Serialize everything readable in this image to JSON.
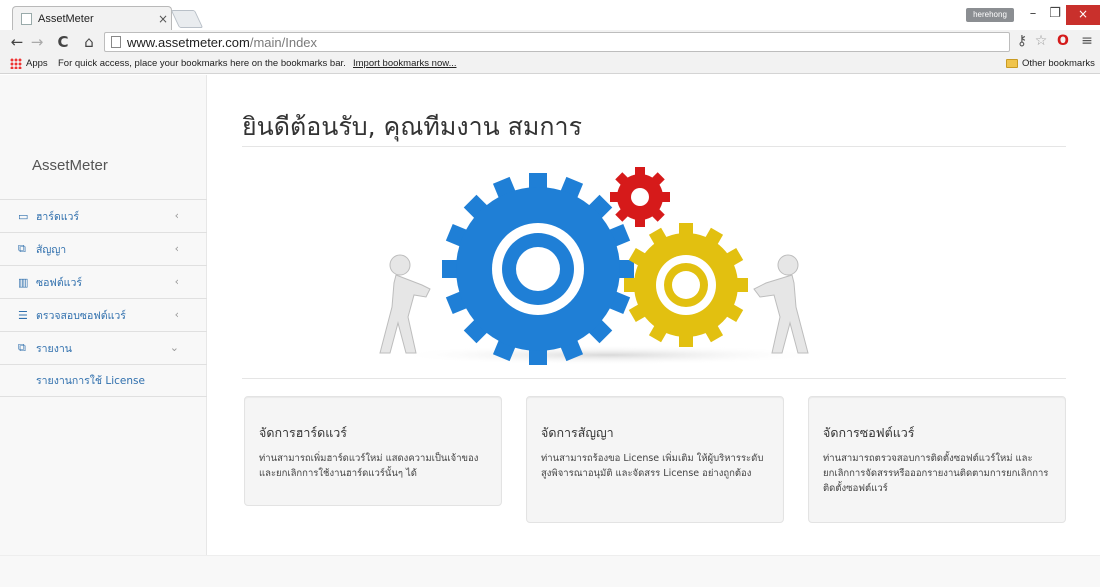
{
  "browser": {
    "tab_title": "AssetMeter",
    "tab_close": "×",
    "user_chip": "herehong",
    "window": {
      "minimize": "–",
      "maximize": "❐",
      "close": "×"
    },
    "nav": {
      "back": "←",
      "forward": "→",
      "reload": "C",
      "home": "⌂"
    },
    "url_host": "www.assetmeter.com",
    "url_path": "/main/Index",
    "toolbar_icons": [
      "key-icon",
      "star-icon",
      "opera-icon",
      "menu-icon"
    ],
    "bookmarks": {
      "apps_label": "Apps",
      "message": "For quick access, place your bookmarks here on the bookmarks bar.",
      "import_link": "Import bookmarks now...",
      "other": "Other bookmarks"
    }
  },
  "sidebar": {
    "brand": "AssetMeter",
    "items": [
      {
        "label": "ฮาร์ดแวร์",
        "icon": "monitor-icon",
        "glyph": "▭",
        "arrow": "‹"
      },
      {
        "label": "สัญญา",
        "icon": "contract-icon",
        "glyph": "⧉",
        "arrow": "‹"
      },
      {
        "label": "ซอฟต์แวร์",
        "icon": "chart-icon",
        "glyph": "▥",
        "arrow": "‹"
      },
      {
        "label": "ตรวจสอบซอฟต์แวร์",
        "icon": "list-icon",
        "glyph": "☰",
        "arrow": "‹"
      },
      {
        "label": "รายงาน",
        "icon": "report-icon",
        "glyph": "⧉",
        "arrow": "⌄"
      }
    ],
    "submenu": "รายงานการใช้ License"
  },
  "main": {
    "heading": "ยินดีต้อนรับ, คุณทีมงาน สมการ",
    "hero_image": "gears-teamwork-illustration",
    "cards": [
      {
        "title": "จัดการฮาร์ดแวร์",
        "text": "ท่านสามารถเพิ่มฮาร์ดแวร์ใหม่ แสดงความเป็นเจ้าของ และยกเลิกการใช้งานฮาร์ดแวร์นั้นๆ ได้"
      },
      {
        "title": "จัดการสัญญา",
        "text": "ท่านสามารถร้องขอ License เพิ่มเติม ให้ผู้บริหารระดับสูงพิจารณาอนุมัติ และจัดสรร License อย่างถูกต้อง"
      },
      {
        "title": "จัดการซอฟต์แวร์",
        "text": "ท่านสามารถตรวจสอบการติดตั้งซอฟต์แวร์ใหม่ และยกเลิกการจัดสรรหรือออกรายงานติดตามการยกเลิกการติดตั้งซอฟต์แวร์"
      }
    ]
  },
  "colors": {
    "link": "#2f6fad",
    "gear_blue": "#1f7fd6",
    "gear_yellow": "#e2c010",
    "gear_red": "#d61a1a",
    "close_red": "#c9302c"
  }
}
